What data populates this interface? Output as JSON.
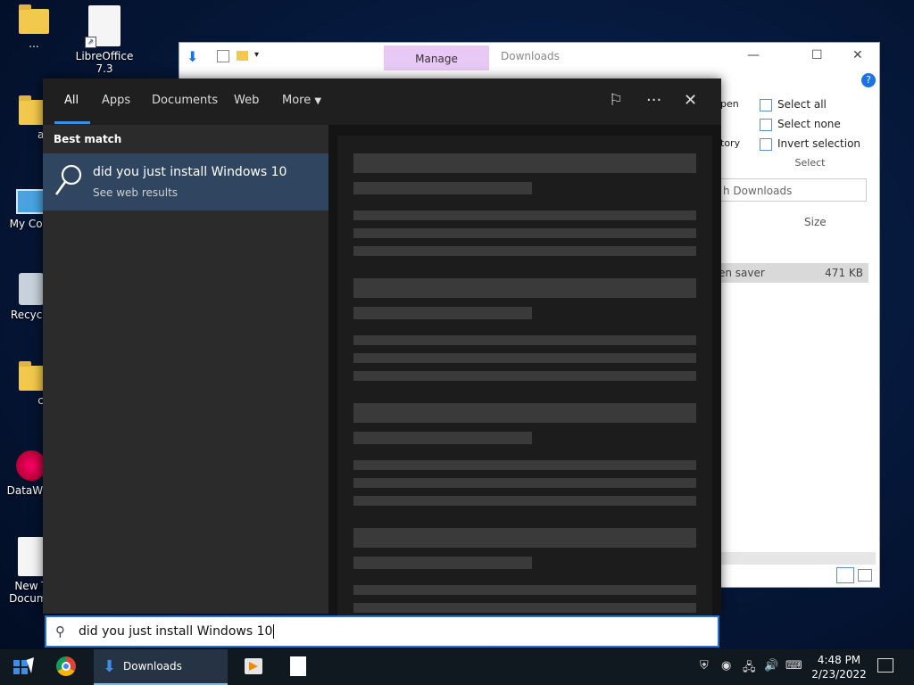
{
  "desktop": {
    "icons": [
      {
        "label": "..."
      },
      {
        "label": "LibreOffice 7.3"
      },
      {
        "label": "aux"
      },
      {
        "label": "My Com"
      },
      {
        "label": "Recycle"
      },
      {
        "label": "con"
      },
      {
        "label": "DataWag"
      },
      {
        "label": "New T Docume"
      }
    ]
  },
  "explorer": {
    "manage_tab": "Manage",
    "title": "Downloads",
    "select_all": "Select all",
    "select_none": "Select none",
    "invert_selection": "Invert selection",
    "select_group": "Select",
    "open_label": "pen",
    "history_label": "tory",
    "search_placeholder": "h Downloads",
    "size_header": "Size",
    "row_name": "en saver",
    "row_size": "471 KB",
    "help": "?"
  },
  "search": {
    "tabs": [
      {
        "label": "All"
      },
      {
        "label": "Apps"
      },
      {
        "label": "Documents"
      },
      {
        "label": "Web"
      },
      {
        "label": "More"
      }
    ],
    "best_match_label": "Best match",
    "best_title": "did you just install Windows 10",
    "best_subtitle": "See web results",
    "query": "did you just install Windows 10"
  },
  "taskbar": {
    "downloads_label": "Downloads",
    "time": "4:48 PM",
    "date": "2/23/2022"
  },
  "colors": {
    "accent": "#3a8ee6",
    "best_match_bg": "#2f4560",
    "manage_bg": "#e8c8f5"
  }
}
